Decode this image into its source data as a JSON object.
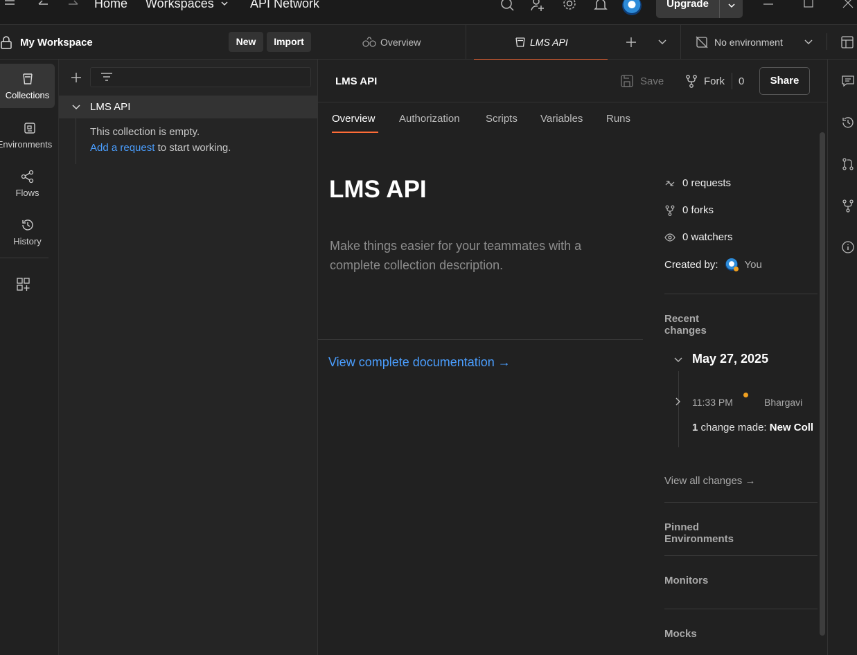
{
  "topbar": {
    "nav": {
      "home": "Home",
      "workspaces": "Workspaces",
      "api_network": "API Network"
    },
    "upgrade_label": "Upgrade",
    "icons": [
      "menu-icon",
      "back-arrow-icon",
      "forward-arrow-icon",
      "search-icon",
      "invite-user-icon",
      "settings-gear-icon",
      "notification-bell-icon",
      "avatar",
      "minimize-icon",
      "maximize-icon",
      "close-icon"
    ]
  },
  "workspace": {
    "name": "My Workspace",
    "new_label": "New",
    "import_label": "Import"
  },
  "rail": {
    "items": [
      {
        "label": "Collections",
        "icon": "collections-icon",
        "active": true
      },
      {
        "label": "Environments",
        "icon": "environments-icon"
      },
      {
        "label": "Flows",
        "icon": "flows-icon"
      },
      {
        "label": "History",
        "icon": "history-icon"
      }
    ]
  },
  "sidebar": {
    "collection_name": "LMS API",
    "empty_text": "This collection is empty.",
    "add_request_link": "Add a request",
    "add_request_suffix": " to start working."
  },
  "tabs": {
    "overview": "Overview",
    "active": "LMS API",
    "environment": "No environment"
  },
  "header": {
    "title": "LMS API",
    "save_label": "Save",
    "fork_label": "Fork",
    "fork_count": "0",
    "share_label": "Share"
  },
  "subtabs": [
    "Overview",
    "Authorization",
    "Scripts",
    "Variables",
    "Runs"
  ],
  "overview": {
    "title": "LMS API",
    "description": "Make things easier for your teammates with a complete collection description.",
    "doc_link": "View complete documentation →"
  },
  "stats": {
    "requests": "0 requests",
    "forks": "0 forks",
    "watchers": "0 watchers",
    "created_by_label": "Created by:",
    "created_by_value": "You"
  },
  "recent": {
    "title": "Recent changes",
    "date": "May 27, 2025",
    "time": "11:33 PM",
    "user": "Bhargavi",
    "change_count": "1",
    "change_text": " change made: ",
    "change_name": "New Coll",
    "view_all": "View all changes →"
  },
  "sections": {
    "pinned": "Pinned Environments",
    "monitors": "Monitors",
    "mocks": "Mocks"
  },
  "colors": {
    "accent": "#ff6c37",
    "link": "#4a9eff",
    "background": "#212121",
    "sidebar": "#252525"
  }
}
